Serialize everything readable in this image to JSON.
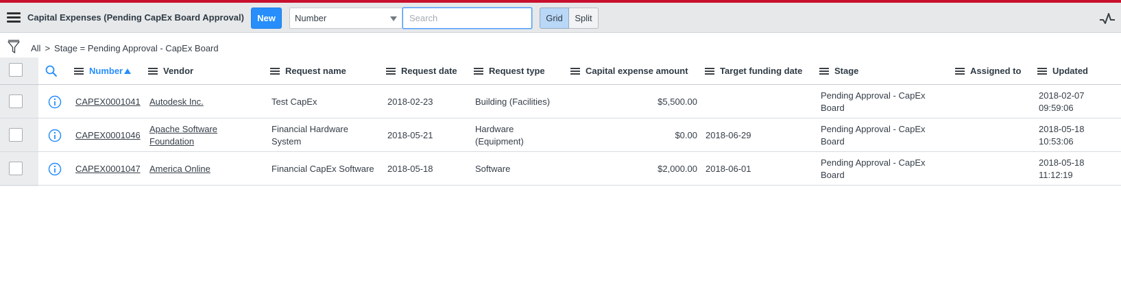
{
  "header": {
    "title": "Capital Expenses (Pending CapEx Board Approval)",
    "new_label": "New",
    "search_field_selected": "Number",
    "search_placeholder": "Search",
    "view_grid_label": "Grid",
    "view_split_label": "Split"
  },
  "breadcrumb": {
    "items": [
      "All",
      "Stage = Pending Approval - CapEx Board"
    ],
    "separator": ">"
  },
  "table": {
    "columns": [
      {
        "label": "Number",
        "sorted": "ascending"
      },
      {
        "label": "Vendor"
      },
      {
        "label": "Request name"
      },
      {
        "label": "Request date"
      },
      {
        "label": "Request type"
      },
      {
        "label": "Capital expense amount"
      },
      {
        "label": "Target funding date"
      },
      {
        "label": "Stage"
      },
      {
        "label": "Assigned to"
      },
      {
        "label": "Updated"
      }
    ],
    "rows": [
      {
        "number": "CAPEX0001041",
        "vendor": [
          "Autodesk Inc."
        ],
        "request_name": [
          "Test CapEx"
        ],
        "request_date": "2018-02-23",
        "request_type": [
          "Building (Facilities)"
        ],
        "amount": "$5,500.00",
        "target_funding_date": "",
        "stage": [
          "Pending Approval - CapEx",
          "Board"
        ],
        "assigned_to": "",
        "updated": [
          "2018-02-07",
          "09:59:06"
        ]
      },
      {
        "number": "CAPEX0001046",
        "vendor": [
          "Apache Software",
          "Foundation"
        ],
        "request_name": [
          "Financial Hardware",
          "System"
        ],
        "request_date": "2018-05-21",
        "request_type": [
          "Hardware",
          "(Equipment)"
        ],
        "amount": "$0.00",
        "target_funding_date": "2018-06-29",
        "stage": [
          "Pending Approval - CapEx",
          "Board"
        ],
        "assigned_to": "",
        "updated": [
          "2018-05-18",
          "10:53:06"
        ]
      },
      {
        "number": "CAPEX0001047",
        "vendor": [
          "America Online"
        ],
        "request_name": [
          "Financial CapEx Software"
        ],
        "request_date": "2018-05-18",
        "request_type": [
          "Software"
        ],
        "amount": "$2,000.00",
        "target_funding_date": "2018-06-01",
        "stage": [
          "Pending Approval - CapEx",
          "Board"
        ],
        "assigned_to": "",
        "updated": [
          "2018-05-18",
          "11:12:19"
        ]
      }
    ]
  },
  "colors": {
    "accent_bar": "#c8102e",
    "primary": "#278efc",
    "header_bg": "#e6e8ea"
  },
  "icons": {
    "menu": "hamburger-menu-icon",
    "activity": "activity-pulse-icon",
    "filter": "funnel-filter-icon",
    "search": "magnifier-search-icon",
    "info": "info-circle-icon",
    "column_menu": "column-menu-icon"
  }
}
